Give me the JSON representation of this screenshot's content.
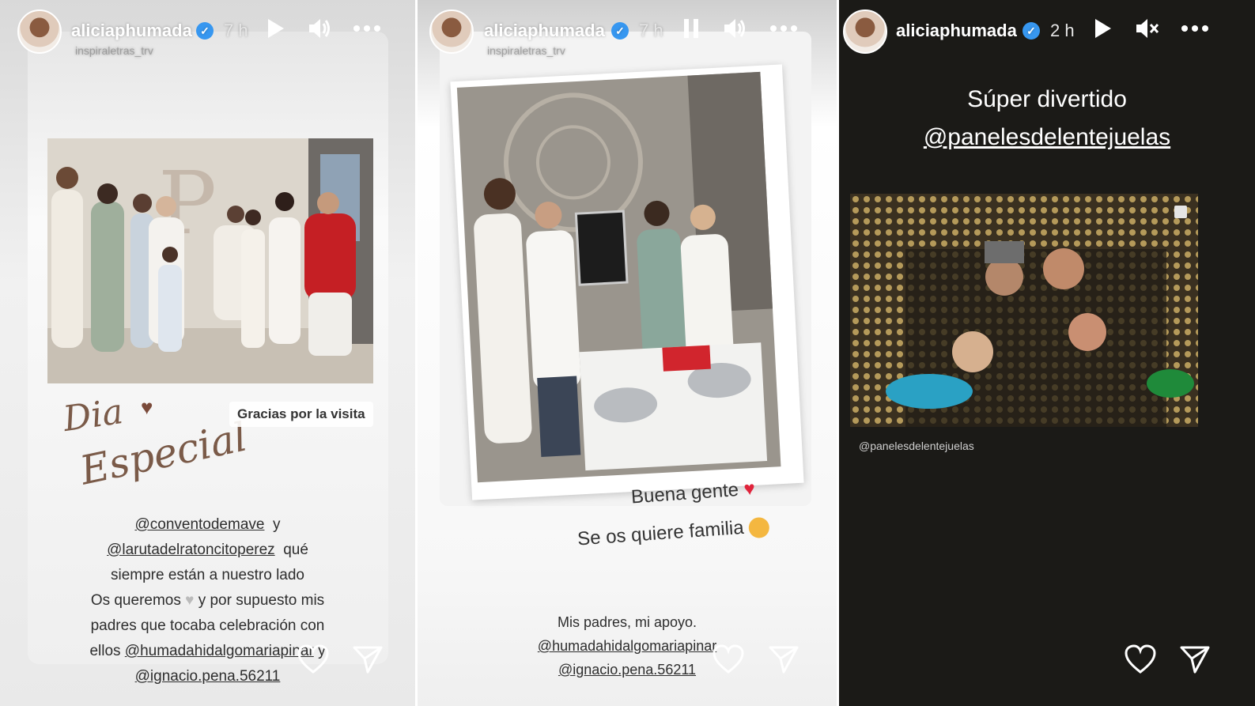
{
  "stories": [
    {
      "username": "aliciaphumada",
      "time": "7 h",
      "sub_user": "inspiraletras_trv",
      "play_icon": "play-icon",
      "sound_icon": "volume-on-icon",
      "script_line1": "Dia",
      "script_line2": "Especial",
      "gracias": "Gracias por la visita",
      "caption": {
        "m1": "@conventodemave",
        "y1": "y",
        "m2": "@larutadelratoncitoperez",
        "que": "qué",
        "l3": "siempre están a nuestro lado",
        "l4a": "Os queremos",
        "l4b": "y por supuesto mis",
        "l5": "padres que tocaba celebración con",
        "l6a": "ellos",
        "m3": "@humadahidalgomariapinar",
        "y2": "y",
        "m4": "@ignacio.pena.56211"
      }
    },
    {
      "username": "aliciaphumada",
      "time": "7 h",
      "sub_user": "inspiraletras_trv",
      "pause_icon": "pause-icon",
      "sound_icon": "volume-on-icon",
      "line1": "Buena gente",
      "line2": "Se os quiere familia",
      "caption_l1": "Mis padres, mi apoyo.",
      "caption_m1": "@humadahidalgomariapinar",
      "caption_m2": "@ignacio.pena.56211"
    },
    {
      "username": "aliciaphumada",
      "time": "2 h",
      "play_icon": "play-icon",
      "sound_icon": "muted-icon",
      "title": "Súper divertido",
      "mention": "@panelesdelentejuelas",
      "photo_tag": "@panelesdelentejuelas"
    }
  ],
  "colors": {
    "verified": "#3797f0",
    "heart_red": "#e0243c",
    "dark_bg": "#1b1a17"
  }
}
